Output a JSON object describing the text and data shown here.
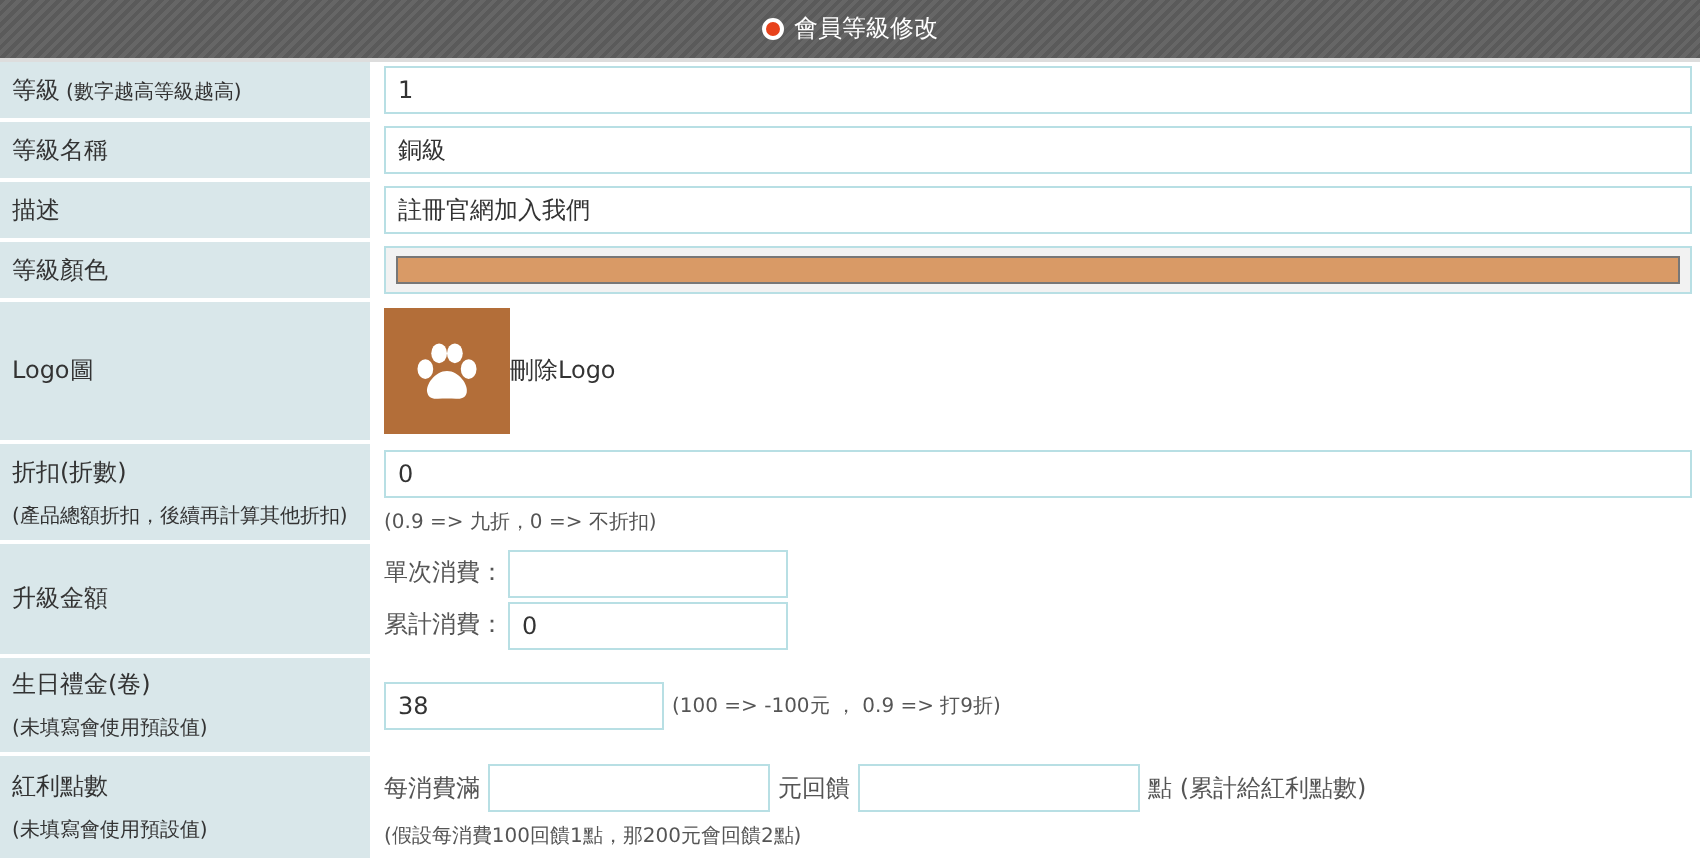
{
  "header": {
    "title": "會員等級修改"
  },
  "rows": [
    {
      "kind": "text",
      "label": "等級",
      "label_note": "(數字越高等級越高)",
      "value": "1"
    },
    {
      "kind": "text",
      "label": "等級名稱",
      "value": "銅級"
    },
    {
      "kind": "text",
      "label": "描述",
      "value": "註冊官網加入我們"
    },
    {
      "kind": "color",
      "label": "等級顏色",
      "color": "#d99a66"
    },
    {
      "kind": "logo",
      "label": "Logo圖",
      "link": "刪除Logo"
    },
    {
      "kind": "text",
      "label": "折扣(折數)",
      "sublabel": "(產品總額折扣，後續再計算其他折扣)",
      "value": "0",
      "hint": "(0.9 => 九折，0 => 不折扣)"
    },
    {
      "kind": "pair",
      "label": "升級金額",
      "fields": [
        {
          "label": "單次消費："
        },
        {
          "label": "累計消費：",
          "value": "0"
        }
      ]
    },
    {
      "kind": "short",
      "label": "生日禮金(卷)",
      "sublabel": "(未填寫會使用預設值)",
      "value": "38",
      "hint": "(100 => -100元 ， 0.9 => 打9折)"
    },
    {
      "kind": "bonus",
      "label": "紅利點數",
      "sublabel": "(未填寫會使用預設值)",
      "prefix": "每消費滿",
      "middle": "元回饋",
      "suffix": "點 (累計給紅利點數)",
      "hint": "(假設每消費100回饋1點，那200元會回饋2點)"
    }
  ]
}
